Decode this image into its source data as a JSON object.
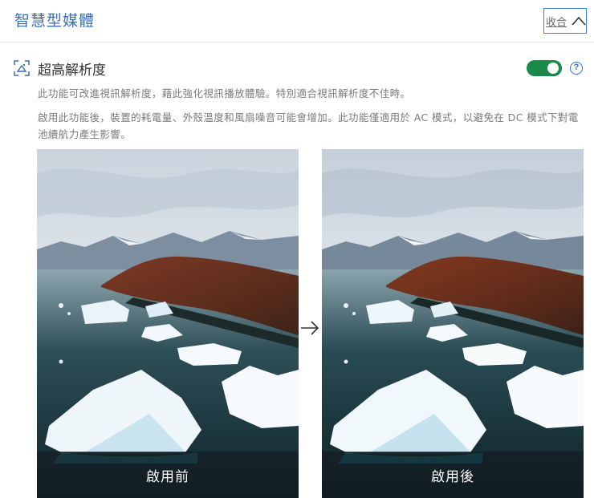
{
  "header": {
    "title": "智慧型媒體",
    "collapse_label": "收合",
    "collapse_icon": "chevron-up-icon"
  },
  "feature": {
    "icon": "super-resolution-icon",
    "title": "超高解析度",
    "toggle_on": true,
    "toggle_color": "#1a8a4a",
    "help_icon": "question-circle-icon",
    "help_glyph": "?",
    "description1": "此功能可改進視訊解析度，藉此強化視訊播放體驗。特別適合視訊解析度不佳時。",
    "description2": "啟用此功能後，裝置的耗電量、外殼溫度和風扇噪音可能會增加。此功能僅適用於 AC 模式，以避免在 DC 模式下對電池續航力產生影響。"
  },
  "comparison": {
    "before_caption": "啟用前",
    "after_caption": "啟用後",
    "arrow_icon": "arrow-right-icon"
  },
  "colors": {
    "accent_blue": "#3b6fb5",
    "focus_border": "#3d7be0",
    "toggle_green": "#1a8a4a"
  }
}
